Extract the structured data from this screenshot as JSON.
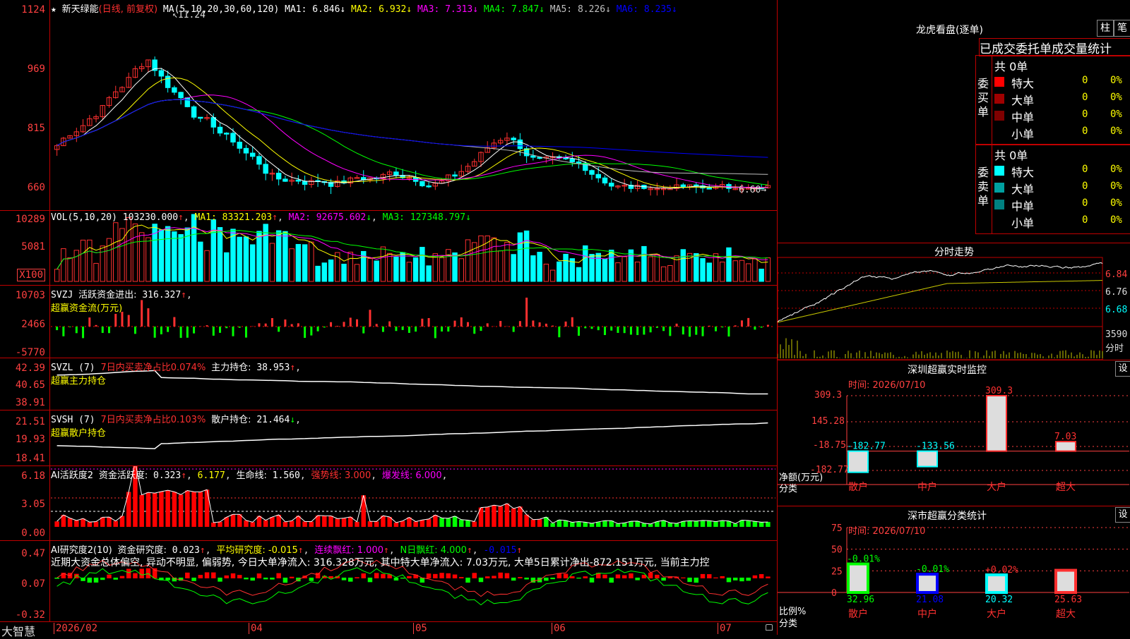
{
  "main": {
    "title": "新天绿能",
    "title_mode": "(日线, 前复权)",
    "ma_params": "MA(5,10,20,30,60,120)",
    "ma_values": [
      {
        "label": "MA1",
        "value": "6.846",
        "dir": "↓",
        "color": "#ffffff"
      },
      {
        "label": "MA2",
        "value": "6.932",
        "dir": "↓",
        "color": "#ffff00"
      },
      {
        "label": "MA3",
        "value": "7.313",
        "dir": "↓",
        "color": "#ff00ff"
      },
      {
        "label": "MA4",
        "value": "7.847",
        "dir": "↓",
        "color": "#00ff00"
      },
      {
        "label": "MA5",
        "value": "8.226",
        "dir": "↓",
        "color": "#c0c0c0"
      },
      {
        "label": "MA6",
        "value": "8.235",
        "dir": "↓",
        "color": "#0000ff"
      }
    ],
    "y_ticks": [
      "1124",
      "969",
      "815",
      "660"
    ],
    "high_marker": "11.24",
    "low_marker": "6.60"
  },
  "vol": {
    "header": "VOL(5,10,20)",
    "value": "103230.000",
    "ma1": "83321.203",
    "ma2": "92675.602",
    "ma3": "127348.797",
    "y_ticks": [
      "10289",
      "5081",
      "X100"
    ]
  },
  "svzj": {
    "header": "SVZJ",
    "label": "活跃资金进出:",
    "value": "316.327",
    "sub": "超赢资金流(万元)",
    "y_ticks": [
      "10703",
      "2466",
      "-5770"
    ]
  },
  "svzl": {
    "header": "SVZL (7)",
    "ratio": "7日内买卖净占比0.074%",
    "label": "主力持仓:",
    "value": "38.953",
    "sub": "超赢主力持仓",
    "y_ticks": [
      "42.39",
      "40.65",
      "38.91"
    ]
  },
  "svsh": {
    "header": "SVSH (7)",
    "ratio": "7日内买卖净占比0.103%",
    "label": "散户持仓:",
    "value": "21.464",
    "sub": "超赢散户持仓",
    "y_ticks": [
      "21.51",
      "19.93",
      "18.41"
    ]
  },
  "ai1": {
    "header": "AI活跃度2",
    "label": "资金活跃度:",
    "value": "0.323",
    "v2": "6.177",
    "life_label": "生命线:",
    "life": "1.560",
    "strong": "强势线: 3.000",
    "burst": "爆发线: 6.000",
    "y_ticks": [
      "6.18",
      "3.05",
      "0.00"
    ]
  },
  "ai2": {
    "header": "AI研究度2(10)",
    "label": "资金研究度:",
    "value": "0.023",
    "avg": "平均研究度: -0.015",
    "cont": "连续飘红: 1.000",
    "nday": "N日飘红: 4.000",
    "last": "-0.015",
    "comment": "近期大资金总体偏空, 异动不明显, 偏弱势, 今日大单净流入: 316.328万元, 其中特大单净流入: 7.03万元, 大单5日累计净出-872.151万元, 当前主力控",
    "y_ticks": [
      "0.47",
      "0.07",
      "-0.32"
    ]
  },
  "bottom": {
    "brand": "大智慧",
    "dates": [
      "2026/02",
      "04",
      "05",
      "06",
      "07"
    ]
  },
  "longhu": {
    "title": "龙虎看盘(逐单)",
    "btn1": "柱",
    "btn2": "笔",
    "tabs_text": "已成交委托单成交量统计",
    "buy_label": "委买单",
    "sell_label": "委卖单",
    "buy_total": "共 0单",
    "sell_total": "共 0单",
    "rows": [
      {
        "name": "特大",
        "count": "0",
        "pct": "0%"
      },
      {
        "name": "大单",
        "count": "0",
        "pct": "0%"
      },
      {
        "name": "中单",
        "count": "0",
        "pct": "0%"
      },
      {
        "name": "小单",
        "count": "0",
        "pct": "0%"
      }
    ],
    "buy_colors": [
      "#ff0000",
      "#a00000",
      "#800000",
      "#000000"
    ],
    "sell_colors": [
      "#00ffff",
      "#00a0a0",
      "#008080",
      "#000000"
    ]
  },
  "intraday": {
    "title": "分时走势",
    "y_ticks": [
      "6.84",
      "6.76",
      "6.68"
    ],
    "vol_tick": "3590",
    "vol_label": "分时"
  },
  "monitor": {
    "title": "深圳超赢实时监控",
    "btn": "设",
    "date": "时间: 2026/07/10",
    "y_ticks": [
      "309.3",
      "145.28",
      "-18.75",
      "-182.77"
    ],
    "ylabel1": "净额(万元)",
    "ylabel2": "分类",
    "cats": [
      "散户",
      "中户",
      "大户",
      "超大"
    ],
    "chart_data": {
      "type": "bar",
      "categories": [
        "散户",
        "中户",
        "大户",
        "超大"
      ],
      "values": [
        -182.77,
        -133.56,
        309.3,
        7.03
      ],
      "ylim": [
        -182.77,
        309.3
      ]
    }
  },
  "stats": {
    "title": "深市超赢分类统计",
    "btn": "设",
    "date": "时间: 2026/07/10",
    "y_ticks": [
      "75",
      "50",
      "25",
      "0"
    ],
    "ylabel1": "比例%",
    "ylabel2": "分类",
    "cats": [
      "散户",
      "中户",
      "大户",
      "超大"
    ],
    "chart_data": {
      "type": "bar",
      "categories": [
        "散户",
        "中户",
        "大户",
        "超大"
      ],
      "values": [
        32.96,
        21.08,
        20.32,
        25.63
      ],
      "deltas": [
        "-0.01%",
        "-0.01%",
        "+0.02%",
        ""
      ],
      "ylim": [
        0,
        75
      ]
    }
  }
}
